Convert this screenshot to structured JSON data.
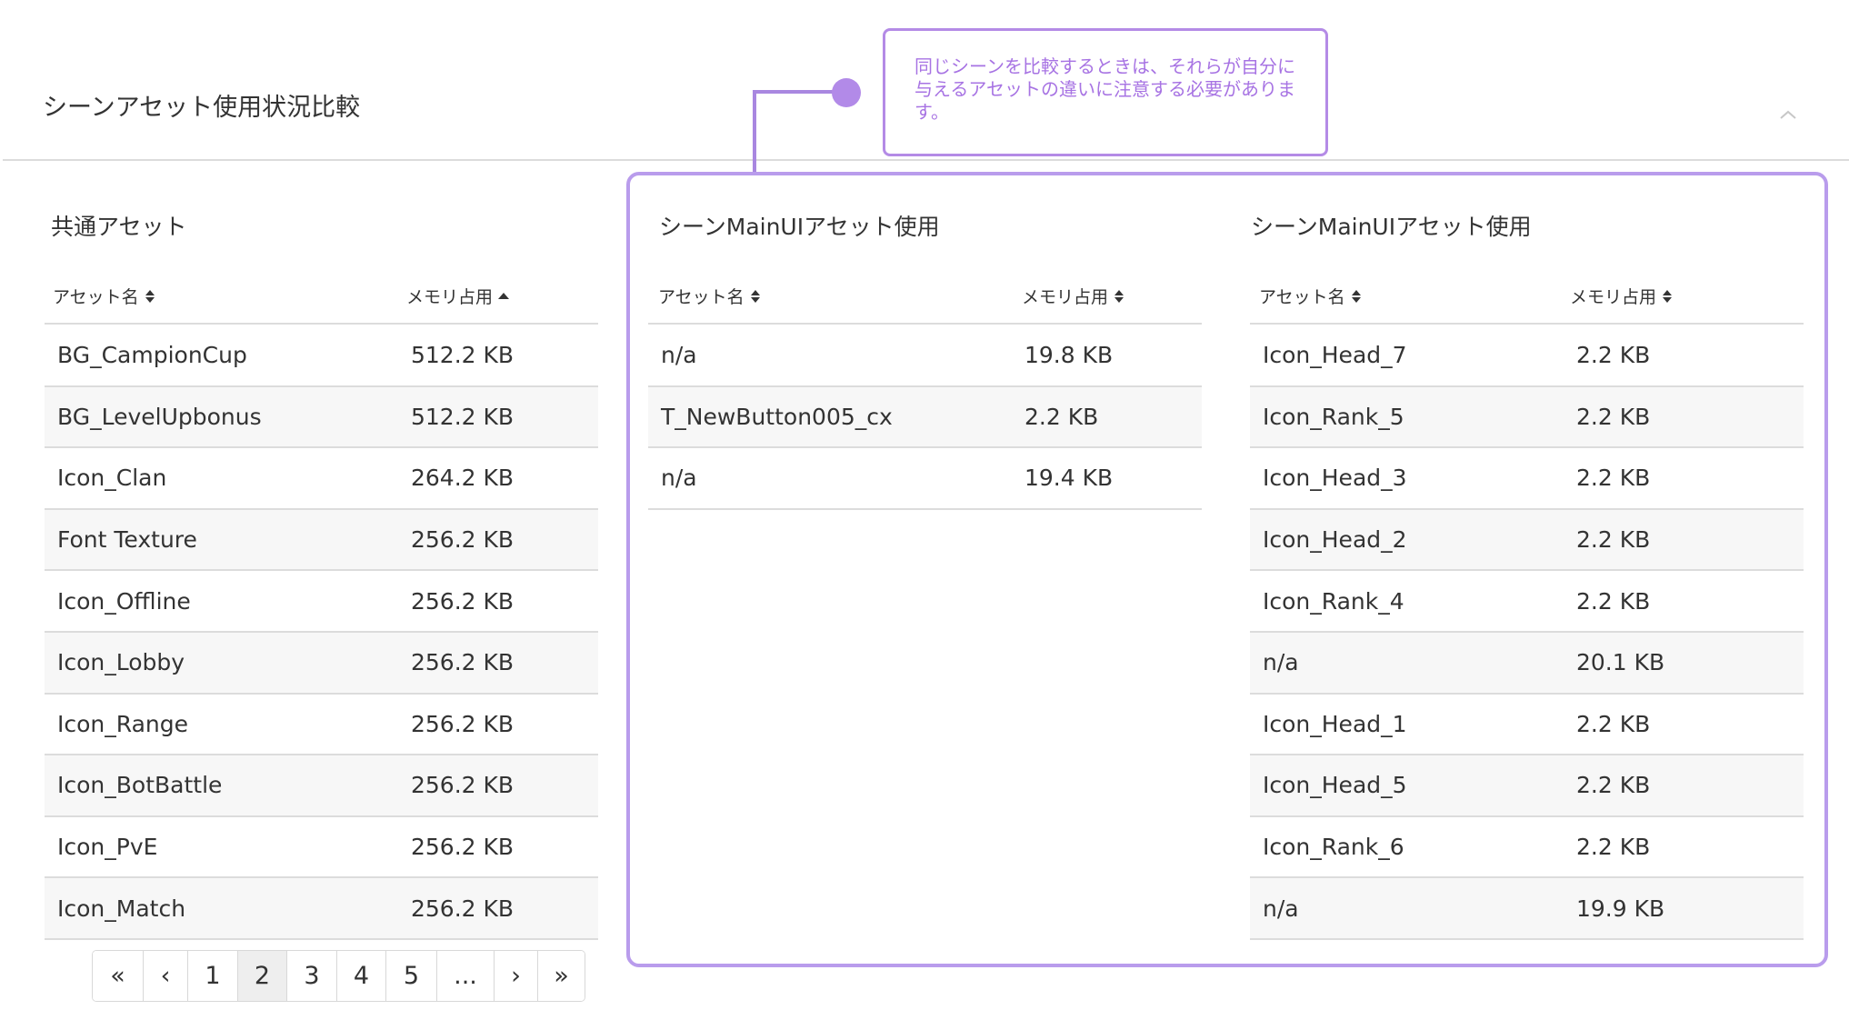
{
  "header": {
    "title": "シーンアセット使用状況比較",
    "collapse_icon": "chevron-up-icon"
  },
  "callout": {
    "text": "同じシーンを比較するときは、それらが自分に与えるアセットの違いに注意する必要があります。",
    "color": "#a773e3"
  },
  "panels": [
    {
      "title": "共通アセット",
      "col_name": "アセット名",
      "col_memory": "メモリ占用",
      "name_sort_icon": "sort-icon",
      "memory_sort_icon": "sort-ascending-icon",
      "rows": [
        {
          "name": "BG_CampionCup",
          "memory": "512.2 KB"
        },
        {
          "name": "BG_LevelUpbonus",
          "memory": "512.2 KB"
        },
        {
          "name": "Icon_Clan",
          "memory": "264.2 KB"
        },
        {
          "name": "Font Texture",
          "memory": "256.2 KB"
        },
        {
          "name": "Icon_Offline",
          "memory": "256.2 KB"
        },
        {
          "name": "Icon_Lobby",
          "memory": "256.2 KB"
        },
        {
          "name": "Icon_Range",
          "memory": "256.2 KB"
        },
        {
          "name": "Icon_BotBattle",
          "memory": "256.2 KB"
        },
        {
          "name": "Icon_PvE",
          "memory": "256.2 KB"
        },
        {
          "name": "Icon_Match",
          "memory": "256.2 KB"
        }
      ]
    },
    {
      "title": "シーンMainUIアセット使用",
      "col_name": "アセット名",
      "col_memory": "メモリ占用",
      "name_sort_icon": "sort-icon",
      "memory_sort_icon": "sort-icon",
      "rows": [
        {
          "name": "n/a",
          "memory": "19.8 KB"
        },
        {
          "name": "T_NewButton005_cx",
          "memory": "2.2 KB"
        },
        {
          "name": "n/a",
          "memory": "19.4 KB"
        }
      ]
    },
    {
      "title": "シーンMainUIアセット使用",
      "col_name": "アセット名",
      "col_memory": "メモリ占用",
      "name_sort_icon": "sort-icon",
      "memory_sort_icon": "sort-icon",
      "rows": [
        {
          "name": "Icon_Head_7",
          "memory": "2.2 KB"
        },
        {
          "name": "Icon_Rank_5",
          "memory": "2.2 KB"
        },
        {
          "name": "Icon_Head_3",
          "memory": "2.2 KB"
        },
        {
          "name": "Icon_Head_2",
          "memory": "2.2 KB"
        },
        {
          "name": "Icon_Rank_4",
          "memory": "2.2 KB"
        },
        {
          "name": "n/a",
          "memory": "20.1 KB"
        },
        {
          "name": "Icon_Head_1",
          "memory": "2.2 KB"
        },
        {
          "name": "Icon_Head_5",
          "memory": "2.2 KB"
        },
        {
          "name": "Icon_Rank_6",
          "memory": "2.2 KB"
        },
        {
          "name": "n/a",
          "memory": "19.9 KB"
        }
      ]
    }
  ],
  "pagination": {
    "first": "«",
    "prev": "‹",
    "pages": [
      "1",
      "2",
      "3",
      "4",
      "5"
    ],
    "ellipsis": "...",
    "next": "›",
    "last": "»",
    "current": "2"
  }
}
